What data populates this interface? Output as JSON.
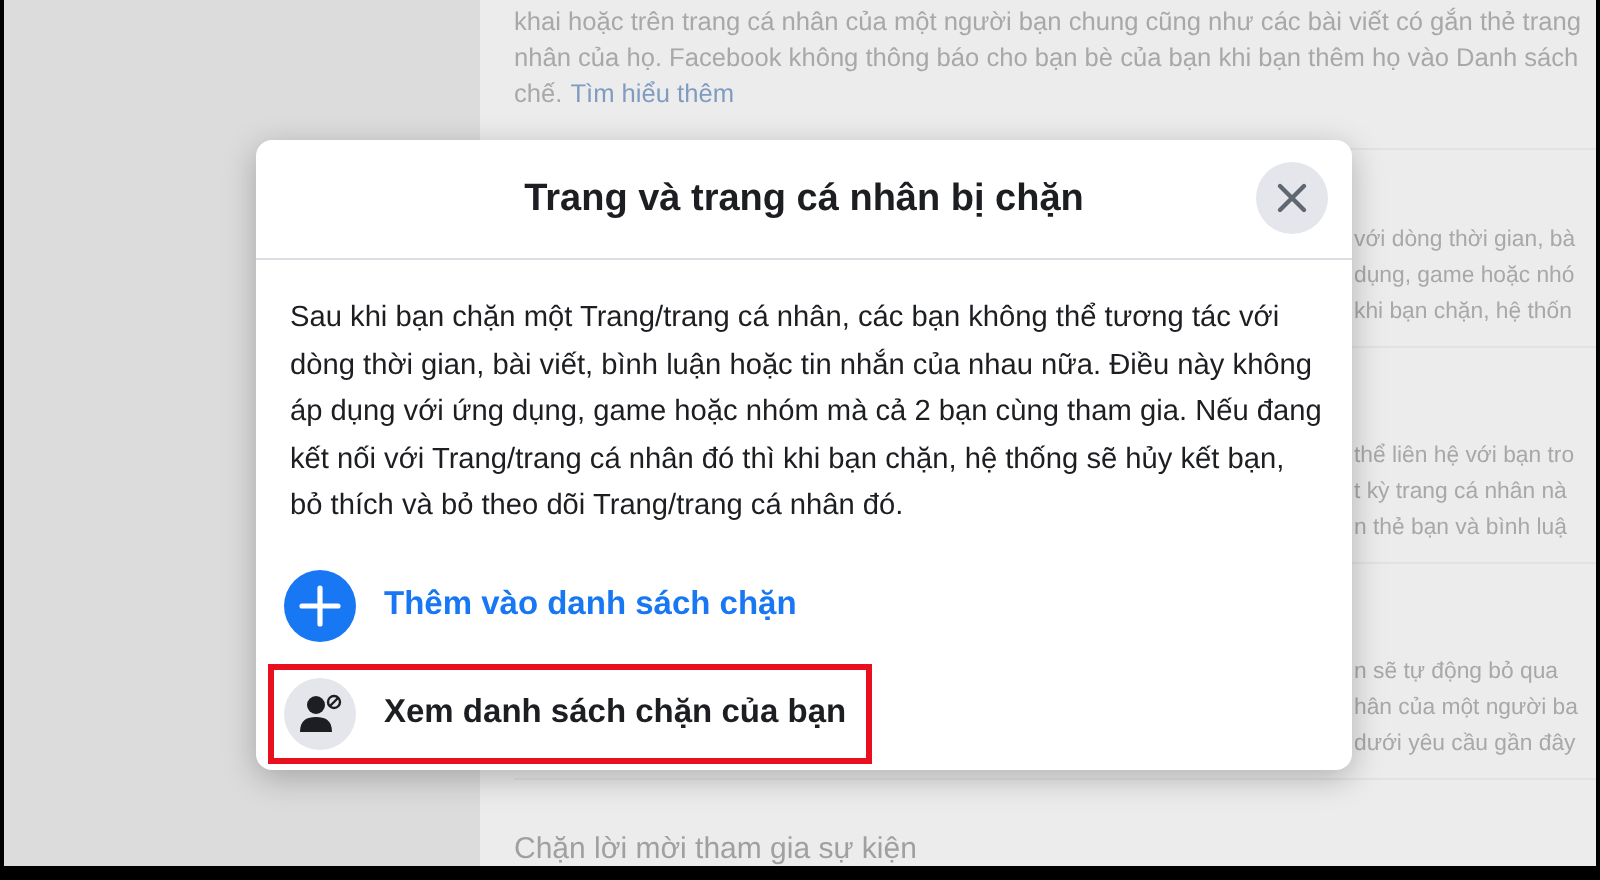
{
  "background": {
    "intro_lines": [
      "khai hoặc trên trang cá nhân của một người bạn chung cũng như các bài viết có gắn thẻ trang",
      "nhân của họ. Facebook không thông báo cho bạn bè của bạn khi bạn thêm họ vào Danh sách"
    ],
    "intro_tail": "chế.",
    "learn_more_link": "Tìm hiểu thêm",
    "sections": [
      {
        "lines": [
          "với dòng thời gian, bà",
          "dụng, game hoặc nhó",
          "khi bạn chặn, hệ thốn"
        ]
      },
      {
        "lines": [
          "thể liên hệ với bạn tro",
          "t kỳ trang cá nhân nà",
          "n thẻ bạn và bình luậ"
        ]
      },
      {
        "lines": [
          "n sẽ tự động bỏ qua",
          "hân của một người ba",
          "dưới yêu cầu gần đây"
        ]
      }
    ],
    "bottom_heading": "Chặn lời mời tham gia sự kiện"
  },
  "dialog": {
    "title": "Trang và trang cá nhân bị chặn",
    "body": "Sau khi bạn chặn một Trang/trang cá nhân, các bạn không thể tương tác với dòng thời gian, bài viết, bình luận hoặc tin nhắn của nhau nữa. Điều này không áp dụng với ứng dụng, game hoặc nhóm mà cả 2 bạn cùng tham gia. Nếu đang kết nối với Trang/trang cá nhân đó thì khi bạn chặn, hệ thống sẽ hủy kết bạn, bỏ thích và bỏ theo dõi Trang/trang cá nhân đó.",
    "actions": [
      {
        "kind": "add",
        "label": "Thêm vào danh sách chặn",
        "highlighted": false
      },
      {
        "kind": "view",
        "label": "Xem danh sách chặn của bạn",
        "highlighted": true
      }
    ]
  }
}
